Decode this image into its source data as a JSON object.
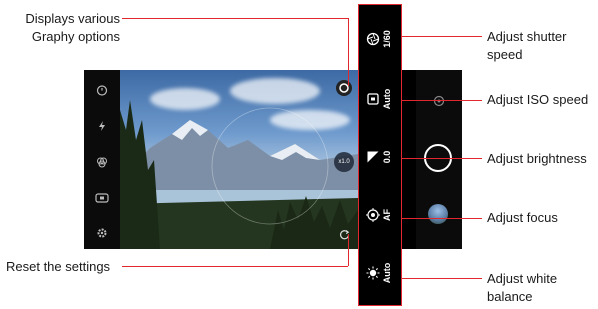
{
  "annotations": {
    "graphy_options": "Displays various\nGraphy options",
    "reset": "Reset the settings",
    "shutter": "Adjust shutter\nspeed",
    "iso": "Adjust ISO speed",
    "brightness": "Adjust brightness",
    "focus": "Adjust focus",
    "white_balance": "Adjust white\nbalance"
  },
  "settings": {
    "shutter_value": "1/60",
    "iso_value": "Auto",
    "brightness_value": "0.0",
    "focus_value": "AF",
    "wb_value": "Auto"
  },
  "viewfinder": {
    "zoom_label": "x1.0"
  },
  "icons": {
    "timer": "timer-icon",
    "flash": "flash-icon",
    "hdr": "filter-icon",
    "ratio": "ratio-icon",
    "settings": "gear-icon",
    "graphy": "graphy-icon",
    "reset": "reset-icon",
    "switch_camera": "switch-camera-icon",
    "shutter_btn": "shutter-button",
    "gallery": "gallery-thumbnail"
  },
  "colors": {
    "callout": "#e0282e",
    "panel": "#000000"
  }
}
